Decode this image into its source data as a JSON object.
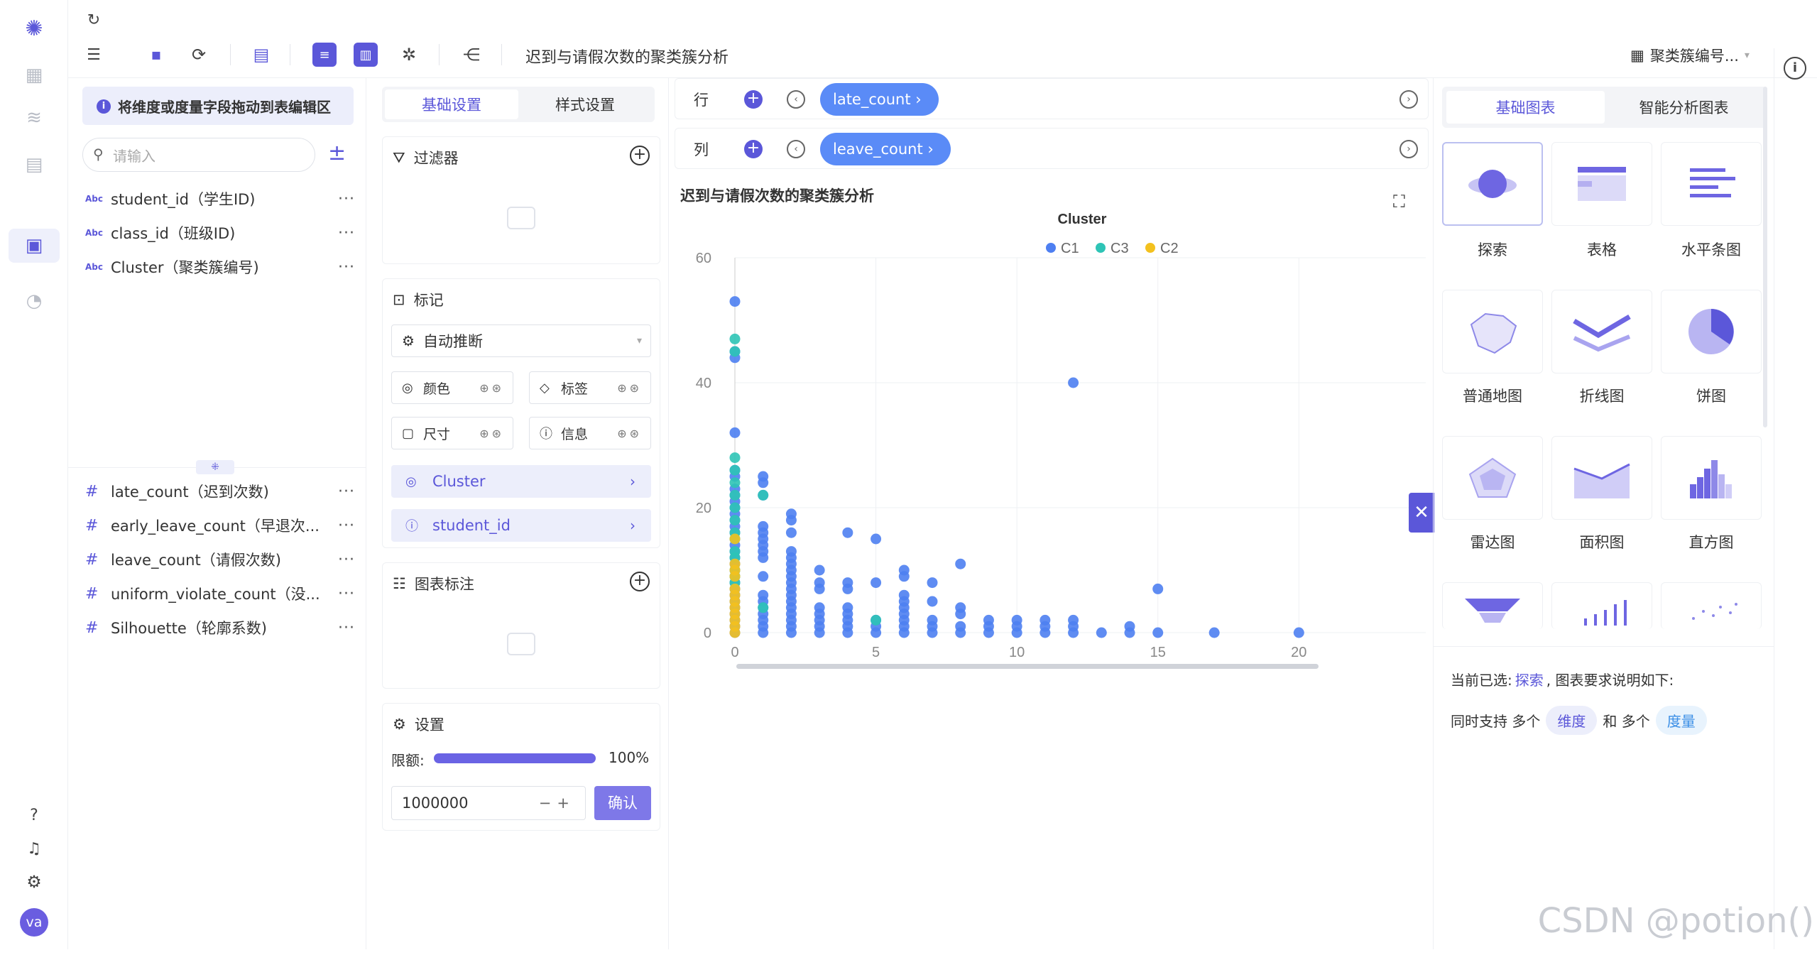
{
  "toolbar": {
    "title": "迟到与请假次数的聚类簇分析",
    "dropdown": "聚类簇编号..."
  },
  "left": {
    "hint": "将维度或度量字段拖动到表编辑区",
    "search_placeholder": "请输入",
    "dimensions": [
      {
        "type": "Abc",
        "label": "student_id（学生ID)"
      },
      {
        "type": "Abc",
        "label": "class_id（班级ID)"
      },
      {
        "type": "Abc",
        "label": "Cluster（聚类簇编号)"
      }
    ],
    "measures": [
      {
        "label": "late_count（迟到次数)"
      },
      {
        "label": "early_leave_count（早退次..."
      },
      {
        "label": "leave_count（请假次数)"
      },
      {
        "label": "uniform_violate_count（没..."
      },
      {
        "label": "Silhouette（轮廓系数)"
      }
    ],
    "more": "···",
    "user_avatar": "va"
  },
  "middle": {
    "tab_basic": "基础设置",
    "tab_style": "样式设置",
    "filter_title": "过滤器",
    "marks_title": "标记",
    "marks_select": "自动推断",
    "mark_color": "颜色",
    "mark_label": "标签",
    "mark_size": "尺寸",
    "mark_info": "信息",
    "pill_cluster": "Cluster",
    "pill_student": "student_id",
    "annot_title": "图表标注",
    "settings_title": "设置",
    "limit_label": "限额:",
    "limit_pct": "100%",
    "limit_value": "1000000",
    "confirm": "确认"
  },
  "center": {
    "row_label": "行",
    "col_label": "列",
    "row_chip": "late_count ›",
    "col_chip": "leave_count ›",
    "chart_title": "迟到与请假次数的聚类簇分析"
  },
  "right": {
    "tab_basic": "基础图表",
    "tab_smart": "智能分析图表",
    "charts": [
      "探索",
      "表格",
      "水平条图",
      "普通地图",
      "折线图",
      "饼图",
      "雷达图",
      "面积图",
      "直方图"
    ],
    "note_prefix": "当前已选:",
    "note_selected": "探索",
    "note_suffix": ", 图表要求说明如下:",
    "req_1": "同时支持 多个",
    "req_dim": "维度",
    "req_2": "和 多个",
    "req_measure": "度量"
  },
  "watermark": "CSDN @potion()",
  "colors": {
    "accent": "#5b57d9",
    "c1": "#4e7ff1",
    "c2": "#f3c11e",
    "c3": "#2ec4b6"
  },
  "chart_data": {
    "type": "scatter",
    "legend_title": "Cluster",
    "legend_position": "top-center",
    "series": [
      {
        "name": "C1",
        "color": "#4e7ff1",
        "points": [
          [
            0,
            53
          ],
          [
            0,
            45
          ],
          [
            0,
            44
          ],
          [
            0,
            32
          ],
          [
            0,
            26
          ],
          [
            0,
            25
          ],
          [
            0,
            23
          ],
          [
            0,
            22
          ],
          [
            0,
            21
          ],
          [
            0,
            20
          ],
          [
            0,
            19
          ],
          [
            0,
            18
          ],
          [
            0,
            17
          ],
          [
            0,
            16
          ],
          [
            0,
            15
          ],
          [
            0,
            14
          ],
          [
            0,
            13
          ],
          [
            0,
            12
          ],
          [
            0,
            11
          ],
          [
            0,
            10
          ],
          [
            0,
            9
          ],
          [
            0,
            8
          ],
          [
            0,
            7
          ],
          [
            0,
            6
          ],
          [
            0,
            5
          ],
          [
            0,
            4
          ],
          [
            0,
            3
          ],
          [
            0,
            2
          ],
          [
            0,
            1
          ],
          [
            0,
            0
          ],
          [
            1,
            25
          ],
          [
            1,
            24
          ],
          [
            1,
            22
          ],
          [
            1,
            17
          ],
          [
            1,
            16
          ],
          [
            1,
            15
          ],
          [
            1,
            14
          ],
          [
            1,
            13
          ],
          [
            1,
            12
          ],
          [
            1,
            9
          ],
          [
            1,
            6
          ],
          [
            1,
            5
          ],
          [
            1,
            4
          ],
          [
            1,
            3
          ],
          [
            1,
            2
          ],
          [
            1,
            1
          ],
          [
            1,
            0
          ],
          [
            2,
            19
          ],
          [
            2,
            18
          ],
          [
            2,
            16
          ],
          [
            2,
            13
          ],
          [
            2,
            12
          ],
          [
            2,
            11
          ],
          [
            2,
            10
          ],
          [
            2,
            9
          ],
          [
            2,
            8
          ],
          [
            2,
            7
          ],
          [
            2,
            6
          ],
          [
            2,
            5
          ],
          [
            2,
            4
          ],
          [
            2,
            3
          ],
          [
            2,
            2
          ],
          [
            2,
            1
          ],
          [
            2,
            0
          ],
          [
            3,
            10
          ],
          [
            3,
            8
          ],
          [
            3,
            7
          ],
          [
            3,
            4
          ],
          [
            3,
            3
          ],
          [
            3,
            2
          ],
          [
            3,
            1
          ],
          [
            3,
            0
          ],
          [
            4,
            16
          ],
          [
            4,
            8
          ],
          [
            4,
            7
          ],
          [
            4,
            4
          ],
          [
            4,
            3
          ],
          [
            4,
            2
          ],
          [
            4,
            1
          ],
          [
            4,
            0
          ],
          [
            5,
            15
          ],
          [
            5,
            8
          ],
          [
            5,
            2
          ],
          [
            5,
            1
          ],
          [
            5,
            0
          ],
          [
            6,
            10
          ],
          [
            6,
            9
          ],
          [
            6,
            6
          ],
          [
            6,
            5
          ],
          [
            6,
            4
          ],
          [
            6,
            3
          ],
          [
            6,
            2
          ],
          [
            6,
            1
          ],
          [
            6,
            0
          ],
          [
            7,
            8
          ],
          [
            7,
            5
          ],
          [
            7,
            2
          ],
          [
            7,
            1
          ],
          [
            7,
            0
          ],
          [
            8,
            11
          ],
          [
            8,
            4
          ],
          [
            8,
            3
          ],
          [
            8,
            1
          ],
          [
            8,
            0
          ],
          [
            9,
            2
          ],
          [
            9,
            1
          ],
          [
            9,
            0
          ],
          [
            10,
            2
          ],
          [
            10,
            1
          ],
          [
            10,
            0
          ],
          [
            11,
            2
          ],
          [
            11,
            1
          ],
          [
            11,
            0
          ],
          [
            12,
            40
          ],
          [
            12,
            2
          ],
          [
            12,
            1
          ],
          [
            12,
            0
          ],
          [
            13,
            0
          ],
          [
            14,
            1
          ],
          [
            14,
            0
          ],
          [
            15,
            7
          ],
          [
            15,
            0
          ],
          [
            17,
            0
          ],
          [
            20,
            0
          ]
        ]
      },
      {
        "name": "C3",
        "color": "#2ec4b6",
        "points": [
          [
            0,
            47
          ],
          [
            0,
            45
          ],
          [
            0,
            28
          ],
          [
            0,
            26
          ],
          [
            0,
            24
          ],
          [
            0,
            22
          ],
          [
            0,
            20
          ],
          [
            0,
            18
          ],
          [
            0,
            16
          ],
          [
            0,
            15
          ],
          [
            0,
            13
          ],
          [
            0,
            12
          ],
          [
            0,
            10
          ],
          [
            0,
            9
          ],
          [
            0,
            8
          ],
          [
            1,
            22
          ],
          [
            1,
            4
          ],
          [
            5,
            2
          ]
        ]
      },
      {
        "name": "C2",
        "color": "#f3c11e",
        "points": [
          [
            0,
            15
          ],
          [
            0,
            11
          ],
          [
            0,
            10
          ],
          [
            0,
            9
          ],
          [
            0,
            7
          ],
          [
            0,
            6
          ],
          [
            0,
            5
          ],
          [
            0,
            4
          ],
          [
            0,
            3
          ],
          [
            0,
            2
          ],
          [
            0,
            1
          ],
          [
            0,
            0
          ]
        ]
      }
    ],
    "x_ticks": [
      0,
      5,
      10,
      15,
      20
    ],
    "y_ticks": [
      0,
      20,
      40,
      60
    ],
    "xlim": [
      0,
      24.5
    ],
    "ylim": [
      0,
      60
    ],
    "grid": true
  }
}
